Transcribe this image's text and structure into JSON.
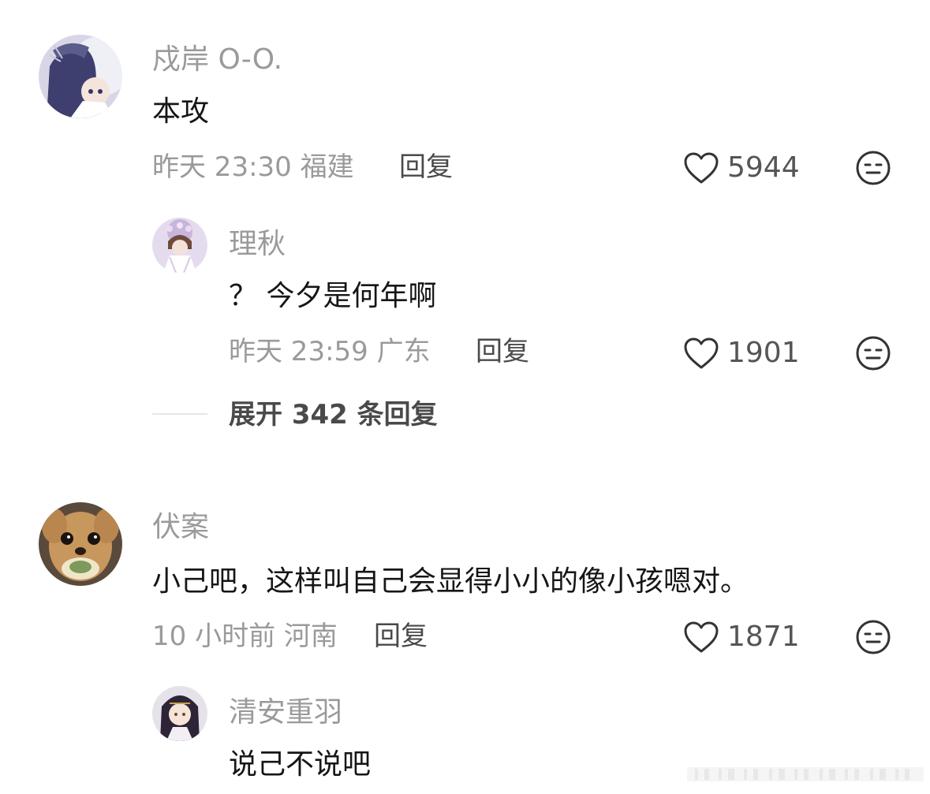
{
  "comments": [
    {
      "user": "戍岸 O-O.",
      "text": "本攻",
      "time": "昨天 23:30",
      "location": "福建",
      "reply_label": "回复",
      "likes": "5944",
      "reply": {
        "user": "理秋",
        "text": "？ 今夕是何年啊",
        "time": "昨天 23:59",
        "location": "广东",
        "reply_label": "回复",
        "likes": "1901"
      },
      "expand_label": "展开 342 条回复"
    },
    {
      "user": "伏案",
      "text": "小己吧，这样叫自己会显得小小的像小孩嗯对。",
      "time": "10 小时前",
      "location": "河南",
      "reply_label": "回复",
      "likes": "1871",
      "reply": {
        "user": "清安重羽",
        "text": "说己不说吧"
      }
    }
  ],
  "icons": {
    "like": "heart-outline-icon",
    "dislike": "neutral-face-icon"
  },
  "colors": {
    "name": "#9a9a9a",
    "text": "#161616",
    "meta": "#9a9a9a",
    "action": "#4a4a4a"
  }
}
